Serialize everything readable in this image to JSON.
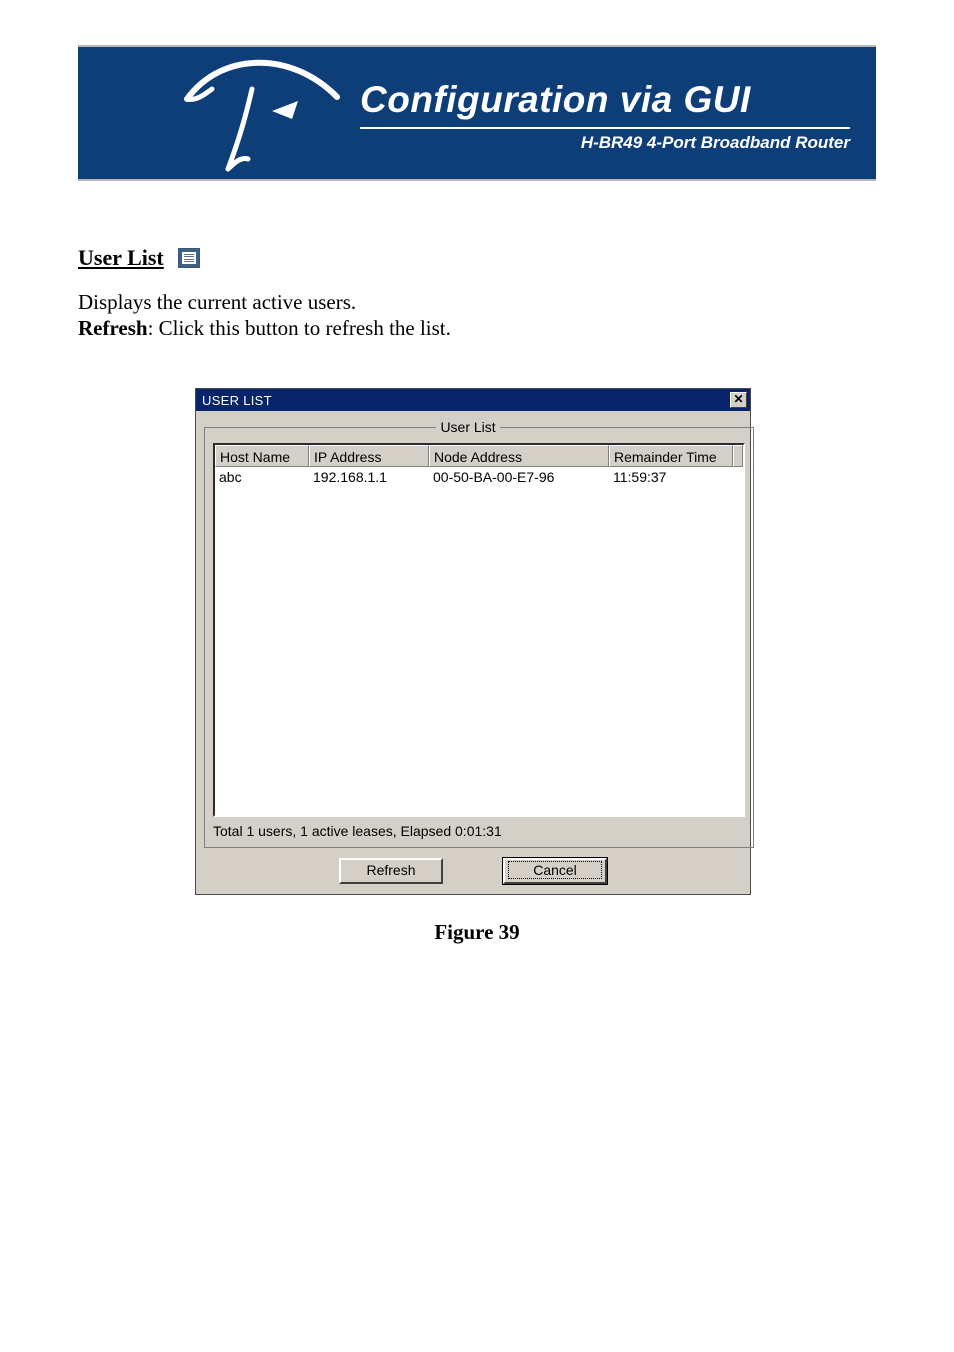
{
  "banner": {
    "title": "Configuration via GUI",
    "subtitle": "H-BR49 4-Port Broadband Router"
  },
  "section": {
    "heading": "User List",
    "line1": "Displays the current active users.",
    "refresh_label": "Refresh",
    "refresh_desc": ": Click this button to refresh the list."
  },
  "dialog": {
    "title": "USER LIST",
    "group_label": "User List",
    "columns": {
      "host": "Host Name",
      "ip": "IP Address",
      "node": "Node Address",
      "remainder": "Remainder Time"
    },
    "rows": [
      {
        "host": "abc",
        "ip": "192.168.1.1",
        "node": "00-50-BA-00-E7-96",
        "remainder": "11:59:37"
      }
    ],
    "status": "Total 1 users, 1 active leases, Elapsed  0:01:31",
    "buttons": {
      "refresh": "Refresh",
      "cancel": "Cancel"
    }
  },
  "figure": "Figure 39"
}
